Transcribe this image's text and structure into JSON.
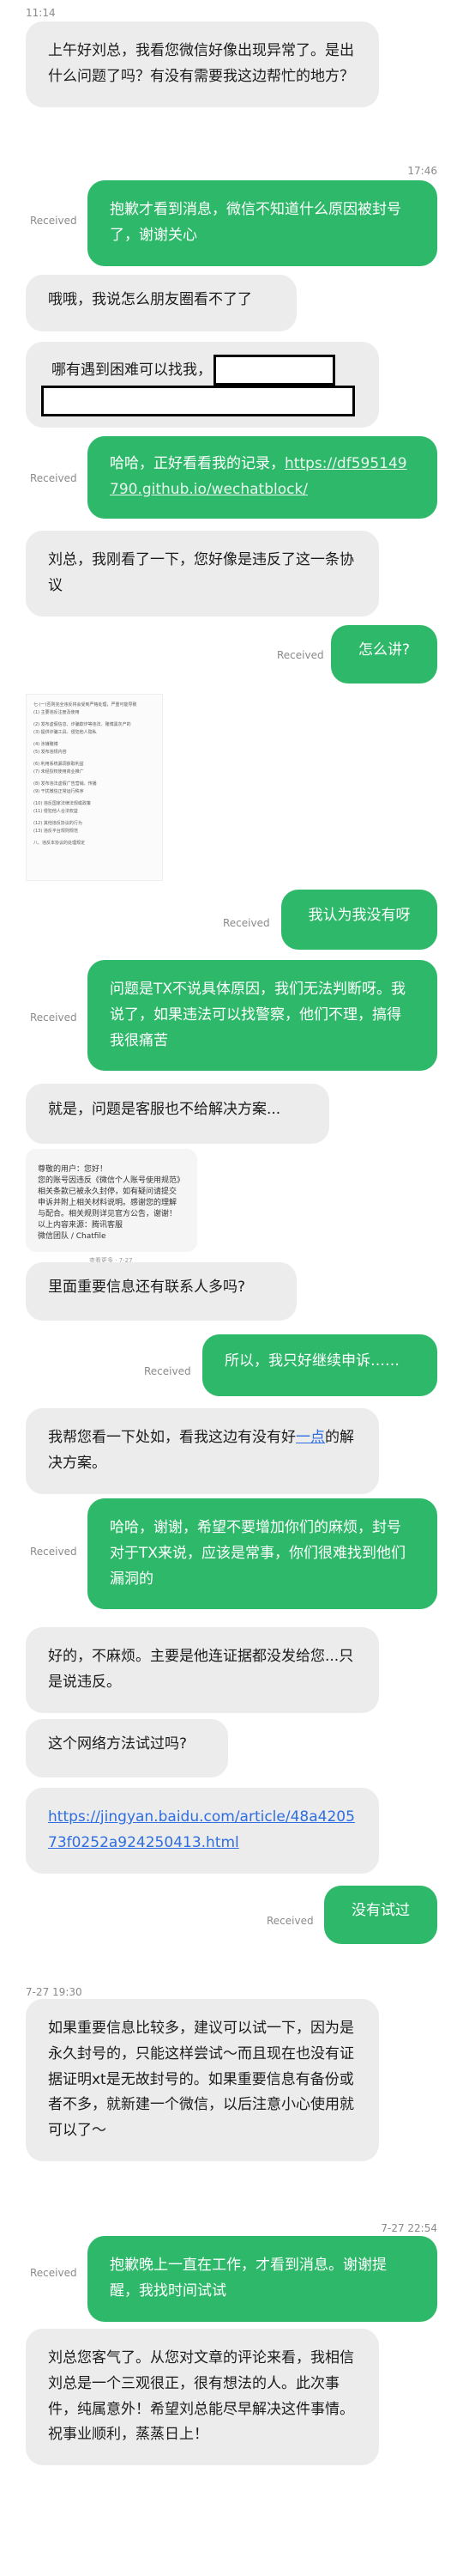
{
  "timestamps": [
    "11:14",
    "17:46",
    "7-27 19:30",
    "7-27 22:54"
  ],
  "received_label": "Received",
  "messages": {
    "m1": "上午好刘总，我看您微信好像出现异常了。是出什么问题了吗？有没有需要我这边帮忙的地方？",
    "m2": "抱歉才看到消息，微信不知道什么原因被封号了，谢谢关心",
    "m3": "哦哦，我说怎么朋友圈看不了了",
    "m4": "哪有遇到困难可以找我，",
    "m5_text": "哈哈，正好看看我的记录，",
    "m5_link": "https://df595149790.github.io/wechatblock/",
    "m6": "刘总，我刚看了一下，您好像是违反了这一条协议",
    "m7": "怎么讲?",
    "m8": "我认为我没有呀",
    "m9": "问题是TX不说具体原因，我们无法判断呀。我说了，如果违法可以找警察，他们不理，搞得我很痛苦",
    "m10": "就是，问题是客服也不给解决方案...",
    "m11": "里面重要信息还有联系人多吗?",
    "m12": "所以，我只好继续申诉……",
    "m13_pre": "我帮您看一下处如，看我这边有没有好",
    "m13_link": "一点",
    "m13_post": "的解决方案。",
    "m14": "哈哈，谢谢，希望不要增加你们的麻烦，封号对于TX来说，应该是常事，你们很难找到他们漏洞的",
    "m15": "好的，不麻烦。主要是他连证据都没发给您...只是说违反。",
    "m16": "这个网络方法试过吗?",
    "m17_link": "https://jingyan.baidu.com/article/48a420573f0252a924250413.html",
    "m18": "没有试过",
    "m19": "如果重要信息比较多，建议可以试一下，因为是永久封号的，只能这样尝试～而且现在也没有证据证明xt是无故封号的。如果重要信息有备份或者不多，就新建一个微信，以后注意小心使用就可以了～",
    "m20": "抱歉晚上一直在工作，才看到消息。谢谢提醒，我找时间试试",
    "m21": "刘总您客气了。从您对文章的评论来看，我相信刘总是一个三观很正，很有想法的人。此次事件，纯属意外！希望刘总能尽早解决这件事情。祝事业顺利，蒸蒸日上！"
  },
  "doc_image_lines": [
    "七·(一)否则完全违反将会受到严格处理，严重可能导致",
    "(1) 主要违反注册及使用",
    "(2) 发布虚假信息、诈骗欺诈等违法、赌博黑灰产的",
    "(3) 提供诈骗工具、侵犯他人隐私",
    "(4) 涉嫌赌博",
    "(5) 发布违规内容",
    "(6) 利用系统漏洞获取利益",
    "(7) 未经授权使用商业推广",
    "(8) 发布违法虚假广告营销、传播",
    "(9) 干扰微信正常运行秩序",
    "(10) 违反国家法律法规或政策",
    "(11) 侵犯他人合法权益",
    "(12) 其他违反协议的行为",
    "(13) 违反平台规则规范",
    "八、违反本协议的处理规定"
  ],
  "note_image_lines": [
    "尊敬的用户：您好！",
    "您的账号因违反《微信个人账号使用规范》",
    "相关条款已被永久封停，如有疑问请提交",
    "申诉并附上相关材料说明。感谢您的理解",
    "与配合。相关规则详见官方公告，谢谢！",
    "以上内容来源：腾讯客服",
    "微信团队 / Chatfile"
  ],
  "note_image_footer": "查看更多 · 7-27"
}
